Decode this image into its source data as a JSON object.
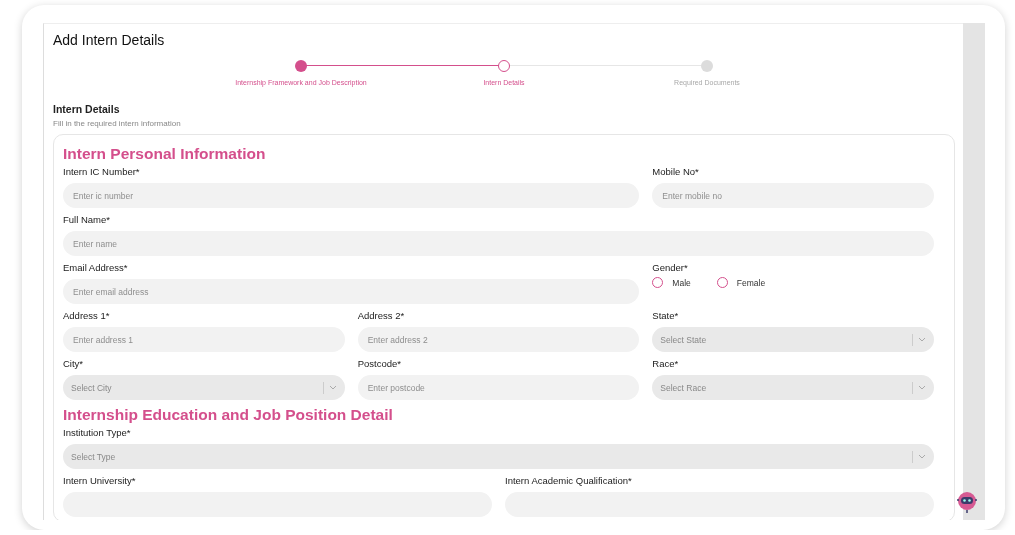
{
  "page": {
    "title": "Add Intern Details"
  },
  "steps": [
    {
      "label": "Internship Framework and Job Description",
      "completed": true,
      "selected": false
    },
    {
      "label": "Intern Details",
      "completed": false,
      "selected": true
    },
    {
      "label": "Required Documents",
      "completed": false,
      "selected": false
    }
  ],
  "form_header": {
    "title": "Intern Details",
    "subtitle": "Fill in the required intern information"
  },
  "sections": [
    {
      "title": "Intern Personal Information",
      "rows": [
        [
          {
            "kind": "text",
            "label": "Intern IC Number*",
            "placeholder": "Enter ic number"
          },
          {
            "kind": "text",
            "label": "Mobile No*",
            "placeholder": "Enter mobile no"
          }
        ],
        [
          {
            "kind": "text",
            "label": "Full Name*",
            "placeholder": "Enter name"
          }
        ],
        [
          {
            "kind": "text",
            "label": "Email Address*",
            "placeholder": "Enter email address"
          },
          {
            "kind": "radio",
            "label": "Gender*",
            "options": [
              {
                "label": "Male",
                "selected": false
              },
              {
                "label": "Female",
                "selected": false
              }
            ]
          }
        ],
        [
          {
            "kind": "text",
            "label": "Address 1*",
            "placeholder": "Enter address 1"
          },
          {
            "kind": "text",
            "label": "Address 2*",
            "placeholder": "Enter address 2"
          },
          {
            "kind": "select",
            "label": "State*",
            "placeholder": "Select State"
          }
        ],
        [
          {
            "kind": "select",
            "label": "City*",
            "placeholder": "Select City"
          },
          {
            "kind": "text",
            "label": "Postcode*",
            "placeholder": "Enter postcode"
          },
          {
            "kind": "select",
            "label": "Race*",
            "placeholder": "Select Race"
          }
        ]
      ]
    },
    {
      "title": "Internship Education and Job Position Detail",
      "rows": [
        [
          {
            "kind": "select",
            "label": "Institution Type*",
            "placeholder": "Select Type"
          }
        ],
        [
          {
            "kind": "text",
            "label": "Intern University*"
          },
          {
            "kind": "text",
            "label": "Intern Academic Qualification*"
          }
        ]
      ]
    }
  ]
}
